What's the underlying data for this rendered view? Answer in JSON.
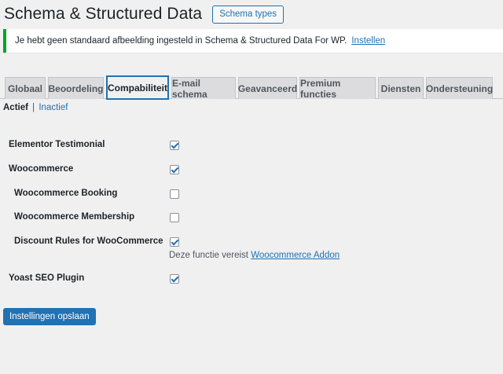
{
  "header": {
    "title": "Schema & Structured Data",
    "types_button": "Schema types"
  },
  "notice": {
    "text": "Je hebt geen standaard afbeelding ingesteld in Schema & Structured Data For WP.",
    "link": "Instellen",
    "accent_color": "#00a32a"
  },
  "tabs": [
    {
      "label": "Globaal"
    },
    {
      "label": "Beoordeling"
    },
    {
      "label": "Compabiliteit"
    },
    {
      "label": "E-mail schema"
    },
    {
      "label": "Geavanceerd"
    },
    {
      "label": "Premium functies"
    },
    {
      "label": "Diensten"
    },
    {
      "label": "Ondersteuning"
    }
  ],
  "active_tab": "Compabiliteit",
  "filter": {
    "active": "Actief",
    "separator": "|",
    "inactive": "Inactief"
  },
  "settings": [
    {
      "label": "Elementor Testimonial",
      "checked": true
    },
    {
      "label": "Woocommerce",
      "checked": true
    },
    {
      "label": "Woocommerce Booking",
      "checked": false
    },
    {
      "label": "Woocommerce Membership",
      "checked": false
    },
    {
      "label": "Discount Rules for WooCommerce",
      "checked": true
    },
    {
      "label": "Yoast SEO Plugin",
      "checked": true
    }
  ],
  "addon_note": {
    "text": "Deze functie vereist",
    "link": "Woocommerce Addon"
  },
  "save_button": "Instellingen opslaan",
  "colors": {
    "accent": "#2271b1",
    "background": "#f0f0f1"
  }
}
